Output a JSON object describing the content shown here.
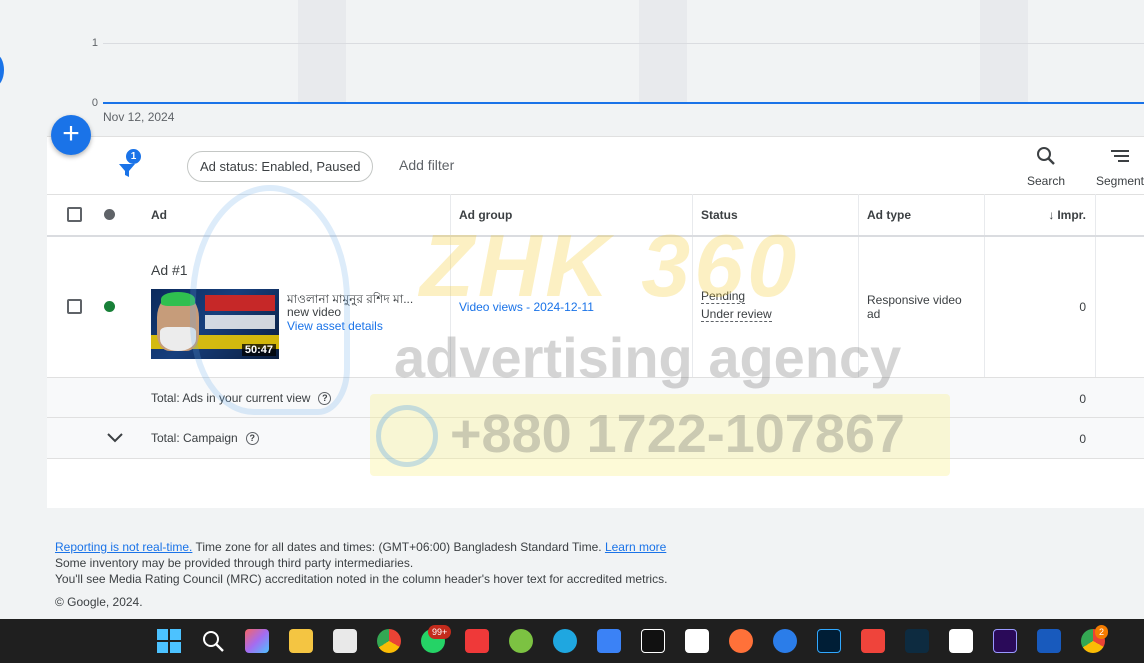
{
  "chart": {
    "y_labels": [
      "1",
      "0"
    ],
    "x_label": "Nov 12, 2024"
  },
  "chart_data": {
    "type": "line",
    "x": [
      "Nov 12, 2024"
    ],
    "series": [
      {
        "values": [
          0
        ]
      }
    ],
    "ylim": [
      0,
      1
    ],
    "grid": true
  },
  "toolbar": {
    "filter_count": "1",
    "status_chip": "Ad status: Enabled, Paused",
    "add_filter": "Add filter",
    "search_label": "Search",
    "segment_label": "Segment"
  },
  "table": {
    "headers": {
      "ad": "Ad",
      "ad_group": "Ad group",
      "status": "Status",
      "ad_type": "Ad type",
      "impr": "Impr."
    },
    "row": {
      "ad_name": "Ad #1",
      "video_title": "মাওলানা মামুনুর রশিদ মা...",
      "video_sub": "new video",
      "asset_link": "View asset details",
      "duration": "50:47",
      "ad_group": "Video views - 2024-12-11",
      "status_1": "Pending",
      "status_2": "Under review",
      "ad_type": "Responsive video ad",
      "impr": "0"
    },
    "totals": [
      {
        "label": "Total: Ads in your current view",
        "impr": "0"
      },
      {
        "label": "Total: Campaign",
        "impr": "0"
      }
    ]
  },
  "footer": {
    "realtime_link": "Reporting is not real-time.",
    "timezone_text": " Time zone for all dates and times: (GMT+06:00) Bangladesh Standard Time. ",
    "learn_more": "Learn more",
    "line2": "Some inventory may be provided through third party intermediaries.",
    "line3": "You'll see Media Rating Council (MRC) accreditation noted in the column header's hover text for accredited metrics.",
    "copyright": "© Google, 2024."
  },
  "watermark": {
    "brand": "ZHK 360",
    "tagline": "advertising agency",
    "phone": "+880 1722-107867"
  },
  "taskbar": {
    "whatsapp_badge": "99+",
    "chrome_badge": "2",
    "icons": [
      "windows-start-icon",
      "search-icon",
      "copilot-icon",
      "file-explorer-icon",
      "snipping-tool-icon",
      "chrome-icon",
      "whatsapp-icon",
      "vivaldi-icon",
      "earth-icon",
      "edge-icon",
      "store-icon",
      "pycharm-icon",
      "capcut-icon",
      "firefox-icon",
      "sync-icon",
      "photoshop-icon",
      "anydesk-icon",
      "filmora-icon",
      "capcut-icon-2",
      "premiere-icon",
      "word-icon",
      "chrome-profile-icon"
    ],
    "colors": {
      "windows": "#4cc2ff",
      "copilot": "#a56bf0",
      "explorer": "#f4c542",
      "snip": "#e9e9e9",
      "chrome": "#34a853",
      "whatsapp": "#25d366",
      "vivaldi": "#ef3939",
      "earth": "#7cc242",
      "edge": "#1fa7e0",
      "store": "#3b82f6",
      "pycharm": "#111111",
      "capcut": "#ffffff",
      "firefox": "#ff7139",
      "sync": "#2b7de9",
      "photoshop": "#001e36",
      "anydesk": "#ef443b",
      "filmora": "#0d2b40",
      "premiere": "#2a0a59",
      "word": "#185abd"
    }
  }
}
